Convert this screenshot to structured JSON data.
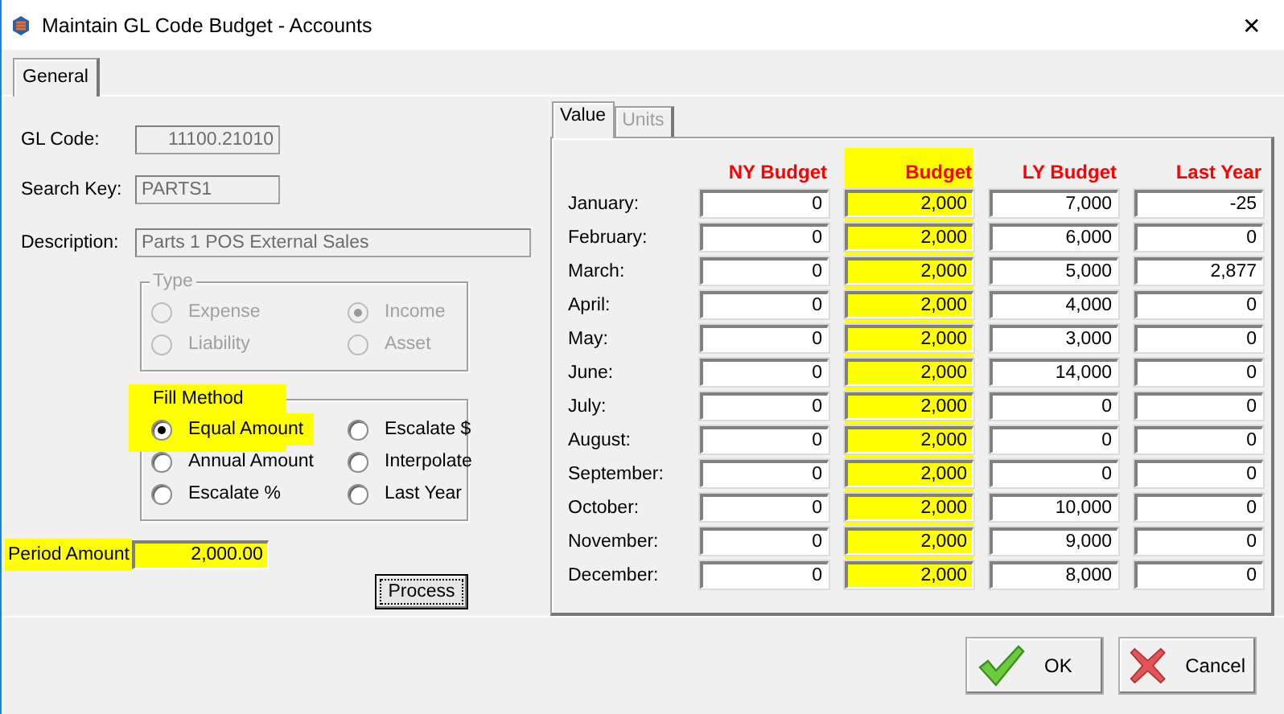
{
  "window": {
    "title": "Maintain GL Code Budget - Accounts",
    "close": "✕"
  },
  "tabs": [
    {
      "label": "General",
      "selected": true
    }
  ],
  "fields": [
    {
      "label": "GL Code:",
      "value": "11100.21010",
      "kind": "short-right",
      "disabled": true
    },
    {
      "label": "Search Key:",
      "value": "PARTS1",
      "kind": "short",
      "disabled": true
    },
    {
      "label": "Description:",
      "value": "Parts 1 POS External Sales",
      "kind": "long",
      "disabled": true
    }
  ],
  "type_group": {
    "title": "Type",
    "disabled": true,
    "options": [
      {
        "label": "Expense",
        "selected": false
      },
      {
        "label": "Income",
        "selected": true
      },
      {
        "label": "Liability",
        "selected": false
      },
      {
        "label": "Asset",
        "selected": false
      }
    ]
  },
  "fill_method": {
    "title": "Fill Method",
    "highlighted": true,
    "options": [
      {
        "label": "Equal Amount",
        "selected": true,
        "highlighted": true
      },
      {
        "label": "Escalate $",
        "selected": false,
        "highlighted": false
      },
      {
        "label": "Annual Amount",
        "selected": false,
        "highlighted": false
      },
      {
        "label": "Interpolate",
        "selected": false,
        "highlighted": false
      },
      {
        "label": "Escalate %",
        "selected": false,
        "highlighted": false
      },
      {
        "label": "Last Year",
        "selected": false,
        "highlighted": false
      }
    ]
  },
  "period_amount": {
    "label": "Period Amount",
    "value": "2,000.00",
    "highlighted": true
  },
  "process_button": {
    "label": "Process"
  },
  "value_tabs": [
    {
      "label": "Value",
      "selected": true,
      "disabled": false
    },
    {
      "label": "Units",
      "selected": false,
      "disabled": true
    }
  ],
  "columns": [
    {
      "label": "NY Budget",
      "highlighted": false
    },
    {
      "label": "Budget",
      "highlighted": true
    },
    {
      "label": "LY Budget",
      "highlighted": false
    },
    {
      "label": "Last Year",
      "highlighted": false
    }
  ],
  "rows": [
    {
      "month": "January:",
      "values": [
        "0",
        "2,000",
        "7,000",
        "-25"
      ]
    },
    {
      "month": "February:",
      "values": [
        "0",
        "2,000",
        "6,000",
        "0"
      ]
    },
    {
      "month": "March:",
      "values": [
        "0",
        "2,000",
        "5,000",
        "2,877"
      ]
    },
    {
      "month": "April:",
      "values": [
        "0",
        "2,000",
        "4,000",
        "0"
      ]
    },
    {
      "month": "May:",
      "values": [
        "0",
        "2,000",
        "3,000",
        "0"
      ]
    },
    {
      "month": "June:",
      "values": [
        "0",
        "2,000",
        "14,000",
        "0"
      ]
    },
    {
      "month": "July:",
      "values": [
        "0",
        "2,000",
        "0",
        "0"
      ]
    },
    {
      "month": "August:",
      "values": [
        "0",
        "2,000",
        "0",
        "0"
      ]
    },
    {
      "month": "September:",
      "values": [
        "0",
        "2,000",
        "0",
        "0"
      ]
    },
    {
      "month": "October:",
      "values": [
        "0",
        "2,000",
        "10,000",
        "0"
      ]
    },
    {
      "month": "November:",
      "values": [
        "0",
        "2,000",
        "9,000",
        "0"
      ]
    },
    {
      "month": "December:",
      "values": [
        "0",
        "2,000",
        "8,000",
        "0"
      ]
    }
  ],
  "buttons": [
    {
      "label": "OK",
      "kind": "ok"
    },
    {
      "label": "Cancel",
      "kind": "cancel"
    }
  ]
}
